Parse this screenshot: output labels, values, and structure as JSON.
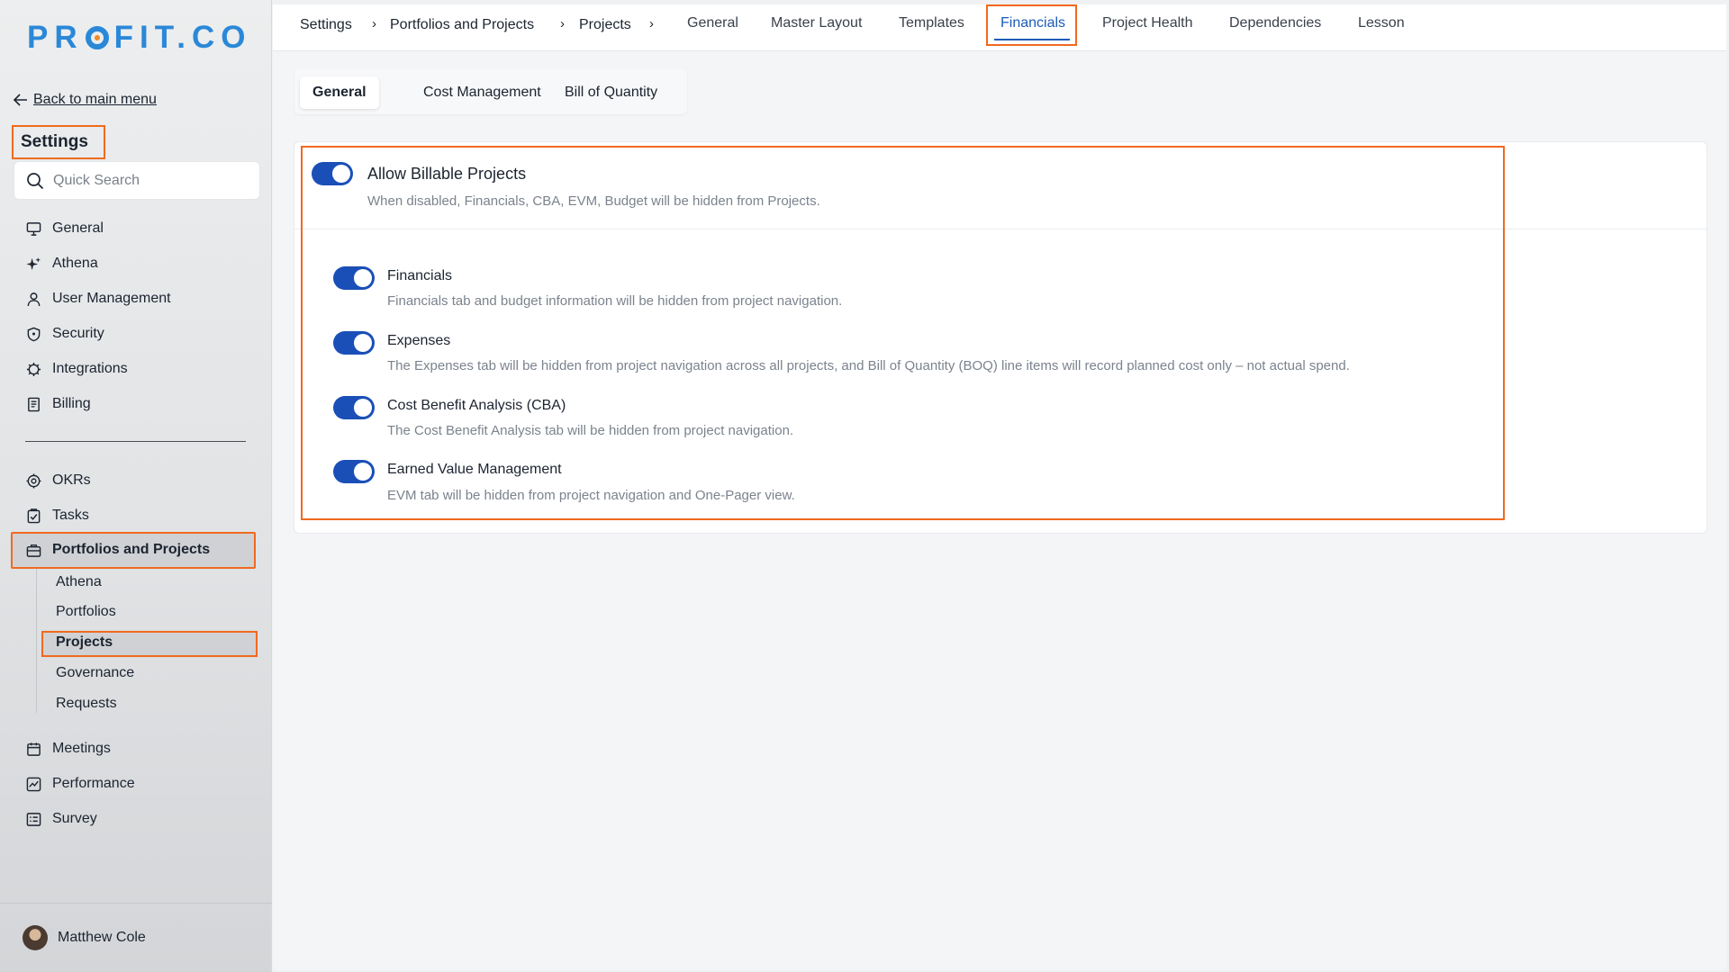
{
  "sidebar": {
    "logo": "PRO FIT.CO",
    "logo_left": "PR",
    "logo_right": "FIT.CO",
    "back_link": "Back to main menu",
    "settings_title": "Settings",
    "search_placeholder": "Quick Search",
    "items": [
      {
        "label": "General",
        "icon": "monitor-icon"
      },
      {
        "label": "Athena",
        "icon": "sparkle-icon"
      },
      {
        "label": "User Management",
        "icon": "user-icon"
      },
      {
        "label": "Security",
        "icon": "shield-icon"
      },
      {
        "label": "Integrations",
        "icon": "gear-icon"
      },
      {
        "label": "Billing",
        "icon": "receipt-icon"
      }
    ],
    "modules": [
      {
        "label": "OKRs",
        "icon": "target-icon"
      },
      {
        "label": "Tasks",
        "icon": "checklist-icon"
      },
      {
        "label": "Portfolios and Projects",
        "icon": "briefcase-icon"
      }
    ],
    "sub_items": [
      "Athena",
      "Portfolios",
      "Projects",
      "Governance",
      "Requests"
    ],
    "other_modules": [
      {
        "label": "Meetings",
        "icon": "calendar-icon"
      },
      {
        "label": "Performance",
        "icon": "chart-icon"
      },
      {
        "label": "Survey",
        "icon": "form-icon"
      }
    ],
    "user_name": "Matthew Cole"
  },
  "topbar": {
    "breadcrumb": [
      "Settings",
      "Portfolios and Projects",
      "Projects"
    ],
    "separator": "›",
    "tabs": [
      "General",
      "Master Layout",
      "Templates",
      "Financials",
      "Project Health",
      "Dependencies",
      "Lesson"
    ],
    "active_tab": "Financials"
  },
  "subtabs": {
    "items": [
      "General",
      "Cost Management",
      "Bill of Quantity"
    ],
    "active": "General"
  },
  "settings": {
    "master": {
      "title": "Allow Billable Projects",
      "desc": "When disabled, Financials, CBA, EVM, Budget will be hidden from Projects.",
      "enabled": true
    },
    "options": [
      {
        "title": "Financials",
        "desc": "Financials tab and budget information will be hidden from project navigation.",
        "enabled": true
      },
      {
        "title": "Expenses",
        "desc": "The Expenses tab will be hidden from project navigation across all projects, and Bill of Quantity (BOQ) line items will record planned cost only – not actual spend.",
        "enabled": true
      },
      {
        "title": "Cost Benefit Analysis (CBA)",
        "desc": "The Cost Benefit Analysis tab will be hidden from project navigation.",
        "enabled": true
      },
      {
        "title": "Earned Value Management",
        "desc": "EVM tab will be hidden from project navigation and One-Pager view.",
        "enabled": true
      }
    ]
  },
  "colors": {
    "accent": "#1a4fb8",
    "highlight": "#f06a1f",
    "logo": "#2b88d8"
  }
}
